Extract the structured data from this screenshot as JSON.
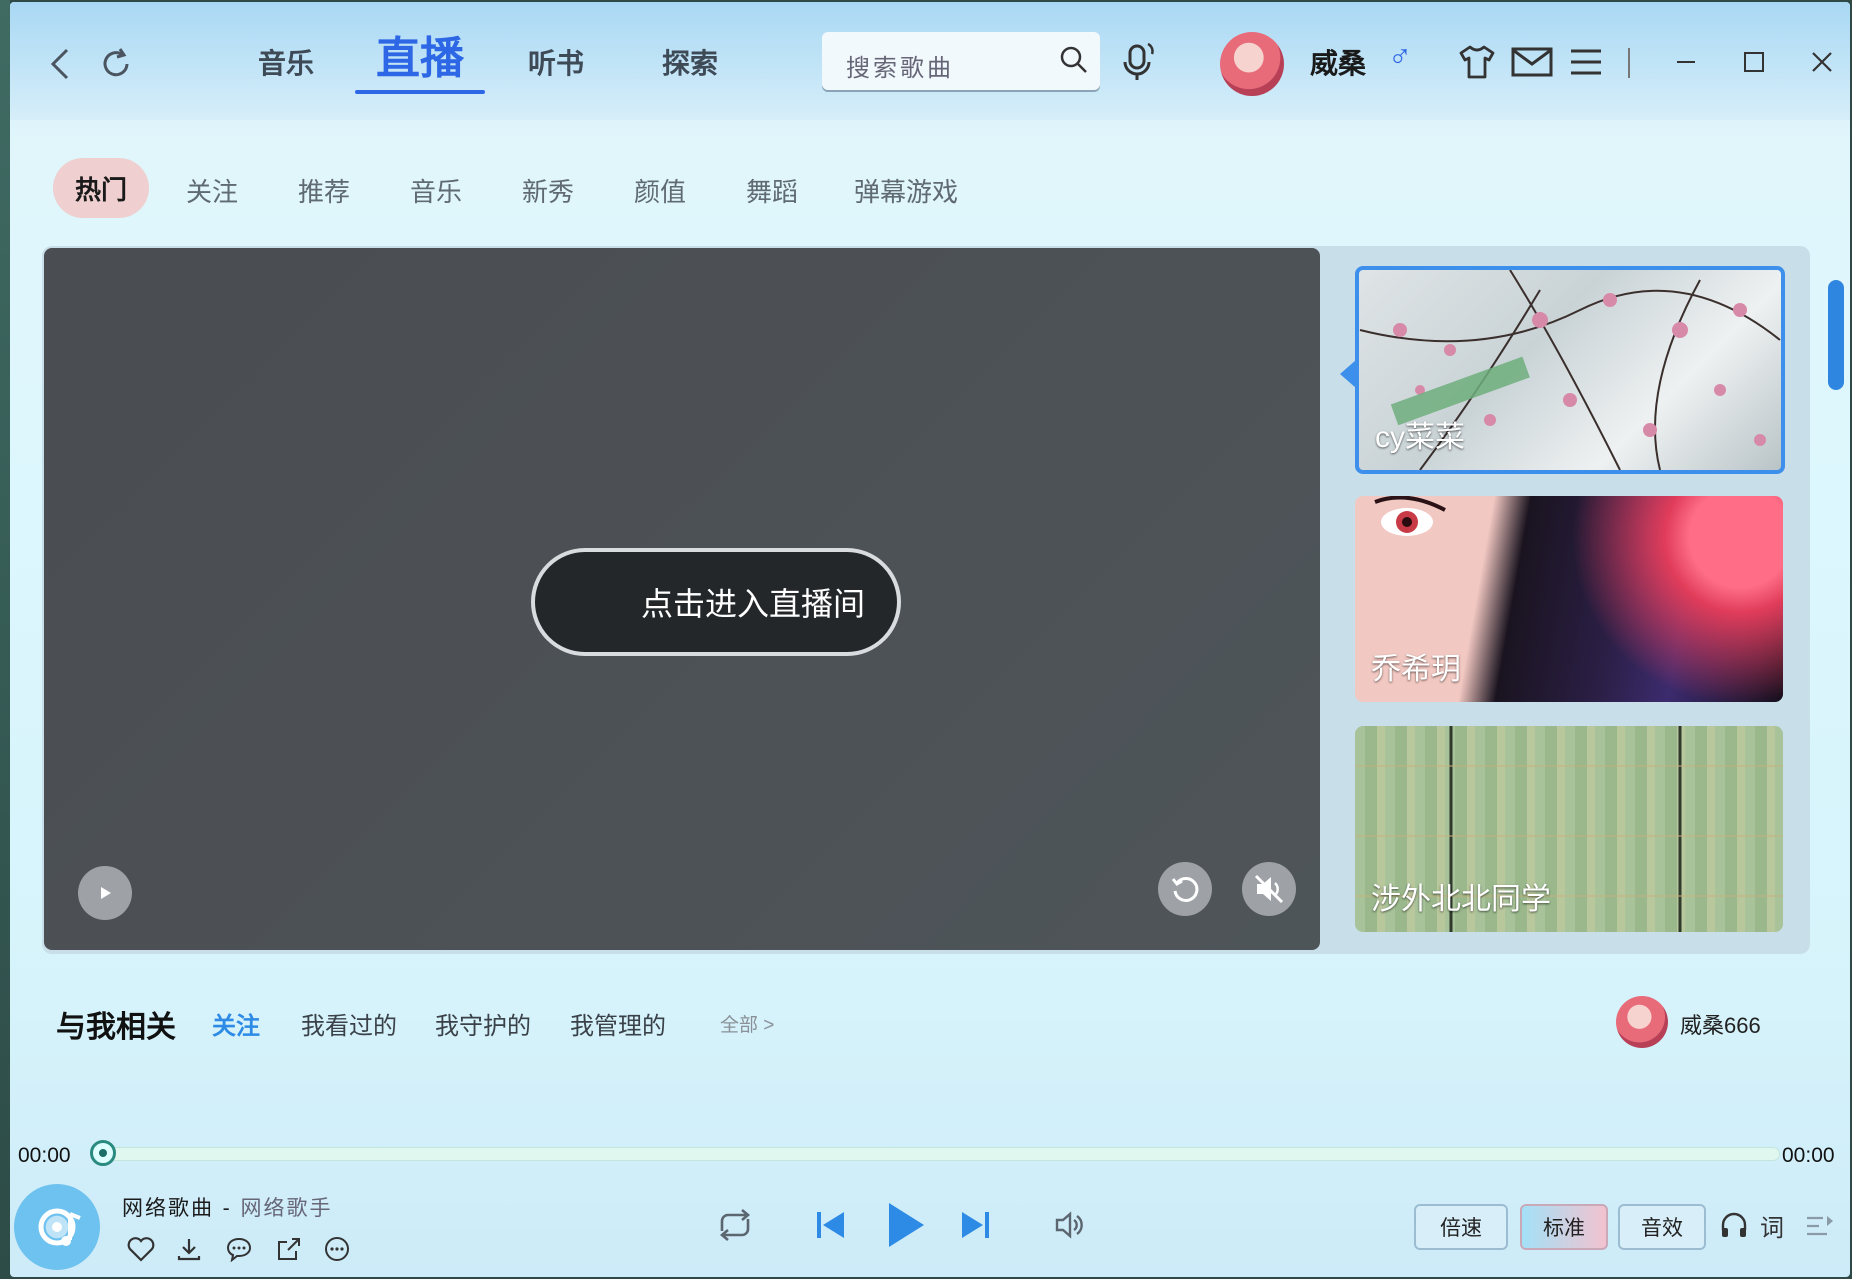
{
  "header": {
    "main_tabs": [
      {
        "label": "音乐"
      },
      {
        "label": "直播"
      },
      {
        "label": "听书"
      },
      {
        "label": "探索"
      }
    ],
    "search": {
      "placeholder": "搜索歌曲"
    },
    "user": {
      "name": "威桑",
      "gender_symbol": "♂"
    }
  },
  "sub_tabs": [
    "热门",
    "关注",
    "推荐",
    "音乐",
    "新秀",
    "颜值",
    "舞蹈",
    "弹幕游戏"
  ],
  "live": {
    "enter_label": "点击进入直播间",
    "rooms": [
      {
        "name": "cy菜菜"
      },
      {
        "name": "乔希玥"
      },
      {
        "name": "涉外北北同学"
      }
    ]
  },
  "related": {
    "title": "与我相关",
    "tabs": [
      "关注",
      "我看过的",
      "我守护的",
      "我管理的"
    ],
    "all_label": "全部 >",
    "user": "威桑666"
  },
  "player": {
    "current_time": "00:00",
    "total_time": "00:00",
    "song_title": "网络歌曲",
    "separator": " - ",
    "artist": "网络歌手",
    "pills": [
      "倍速",
      "标准",
      "音效"
    ],
    "lyric_label": "词"
  },
  "colors": {
    "accent": "#2d67e6",
    "selected_border": "#3d8fec",
    "related_active": "#2d8be6"
  }
}
